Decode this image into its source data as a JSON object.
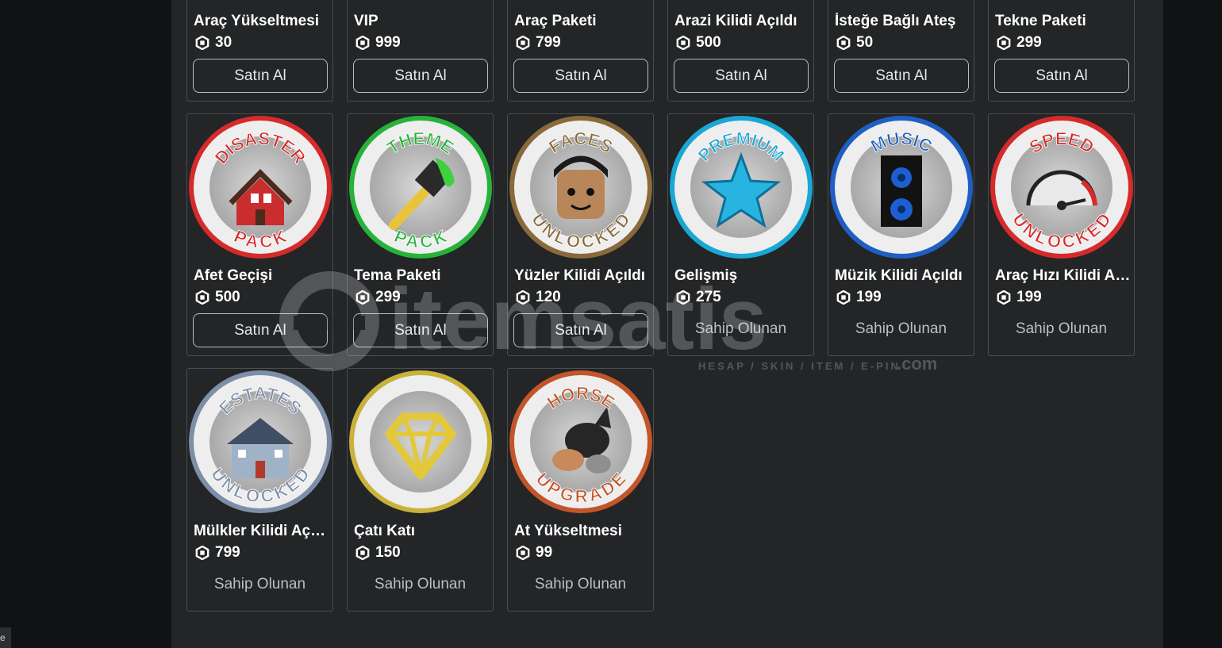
{
  "buy_label": "Satın Al",
  "owned_label": "Sahip Olunan",
  "currency_icon": "robux-icon",
  "watermark": {
    "brand": "itemsatis",
    "tagline": "HESAP / SKIN / ITEM / E-PIN",
    "suffix": ".com"
  },
  "corner_label": "e",
  "items": [
    {
      "name": "Araç Yükseltmesi",
      "price": "30",
      "state": "buy"
    },
    {
      "name": "VIP",
      "price": "999",
      "state": "buy"
    },
    {
      "name": "Araç Paketi",
      "price": "799",
      "state": "buy"
    },
    {
      "name": "Arazi Kilidi Açıldı",
      "price": "500",
      "state": "buy"
    },
    {
      "name": "İsteğe Bağlı Ateş",
      "price": "50",
      "state": "buy"
    },
    {
      "name": "Tekne Paketi",
      "price": "299",
      "state": "buy"
    },
    {
      "name": "Afet Geçişi",
      "price": "500",
      "state": "buy",
      "badge": {
        "top": "DISASTER",
        "bottom": "PACK",
        "ring": "#d62b2b",
        "icon": "house"
      }
    },
    {
      "name": "Tema Paketi",
      "price": "299",
      "state": "buy",
      "badge": {
        "top": "THEME",
        "bottom": "PACK",
        "ring": "#27b33a",
        "icon": "brush"
      }
    },
    {
      "name": "Yüzler Kilidi Açıldı",
      "price": "120",
      "state": "buy",
      "badge": {
        "top": "FACES",
        "bottom": "UNLOCKED",
        "ring": "#8a6a3a",
        "icon": "face"
      }
    },
    {
      "name": "Gelişmiş",
      "price": "275",
      "state": "owned",
      "badge": {
        "top": "PREMIUM",
        "bottom": "",
        "ring": "#1aa7d6",
        "icon": "star"
      }
    },
    {
      "name": "Müzik Kilidi Açıldı",
      "price": "199",
      "state": "owned",
      "badge": {
        "top": "MUSIC",
        "bottom": "",
        "ring": "#1f5fc4",
        "icon": "speaker"
      }
    },
    {
      "name": "Araç Hızı Kilidi Açıldı",
      "price": "199",
      "state": "owned",
      "badge": {
        "top": "SPEED",
        "bottom": "UNLOCKED",
        "ring": "#d62b2b",
        "icon": "gauge"
      }
    },
    {
      "name": "Mülkler Kilidi Açıldı",
      "price": "799",
      "state": "owned",
      "badge": {
        "top": "ESTATES",
        "bottom": "UNLOCKED",
        "ring": "#7d8fa8",
        "icon": "mansion"
      }
    },
    {
      "name": "Çatı Katı",
      "price": "150",
      "state": "owned",
      "badge": {
        "top": "",
        "bottom": "",
        "ring": "#c9b23a",
        "icon": "diamond"
      }
    },
    {
      "name": "At Yükseltmesi",
      "price": "99",
      "state": "owned",
      "badge": {
        "top": "HORSE",
        "bottom": "UPGRADE",
        "ring": "#c2562a",
        "icon": "horse"
      }
    }
  ]
}
